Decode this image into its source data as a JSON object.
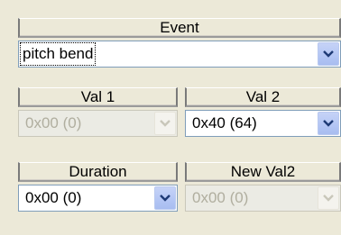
{
  "event": {
    "header": "Event",
    "value": "pitch bend"
  },
  "val1": {
    "header": "Val 1",
    "value": "0x00  (0)",
    "enabled": false
  },
  "val2": {
    "header": "Val 2",
    "value": "0x40  (64)",
    "enabled": true
  },
  "duration": {
    "header": "Duration",
    "value": "0x00  (0)",
    "enabled": true
  },
  "newval2": {
    "header": "New Val2",
    "value": "0x00  (0)",
    "enabled": false
  },
  "icons": {
    "dropdown": "chevron-down-icon"
  },
  "colors": {
    "panel_bg": "#ece9d8",
    "combo_border": "#7f9db9",
    "button_face": "#b3c5f4",
    "disabled_text": "#b0ae9f"
  }
}
